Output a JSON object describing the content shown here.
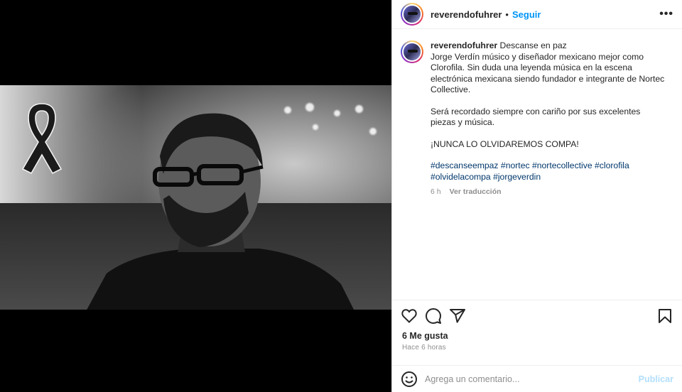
{
  "header": {
    "username": "reverendofuhrer",
    "separator": "•",
    "follow_label": "Seguir",
    "more_icon": "more-horizontal-icon"
  },
  "caption": {
    "username": "reverendofuhrer",
    "first_line": "Descanse en paz",
    "paragraph1": "Jorge Verdín músico y diseñador mexicano mejor como Clorofila. Sin duda una leyenda música en la escena electrónica mexicana siendo fundador e integrante de Nortec Collective.",
    "paragraph2": "Será recordado siempre con cariño por sus excelentes piezas y música.",
    "paragraph3": "¡NUNCA LO OLVIDAREMOS COMPA!",
    "hashtags_line1": "#descanseempaz #nortec #nortecollective #clorofila",
    "hashtags_line2": "#olvidelacompa #jorgeverdin",
    "time": "6 h",
    "translate_label": "Ver traducción"
  },
  "actions": {
    "icons": [
      "heart-icon",
      "comment-icon",
      "share-icon",
      "bookmark-icon"
    ]
  },
  "likes": "6 Me gusta",
  "posted_ago": "Hace 6 horas",
  "comment_box": {
    "placeholder": "Agrega un comentario...",
    "post_label": "Publicar"
  },
  "colors": {
    "accent": "#0095f6",
    "hashtag": "#00376b",
    "muted": "#8e8e8e",
    "post_disabled": "#b2dffc"
  }
}
